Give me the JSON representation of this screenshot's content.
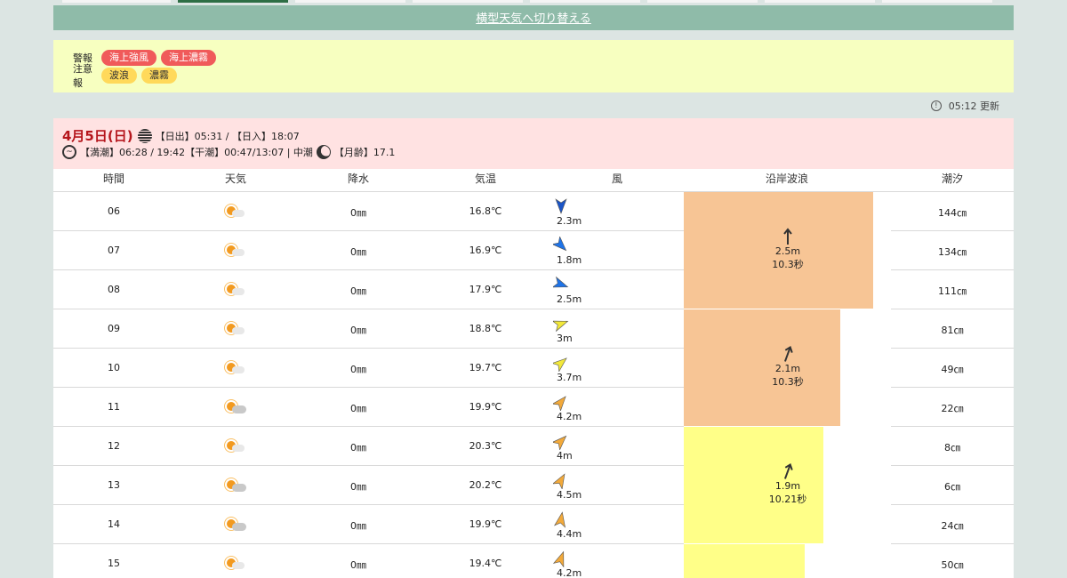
{
  "switch_link": "横型天気へ切り替える",
  "alerts": {
    "warning_label": "警報",
    "warnings": [
      "海上強風",
      "海上濃霧"
    ],
    "advisory_label": "注意報",
    "advisories": [
      "波浪",
      "濃霧"
    ]
  },
  "update": {
    "time": "05:12 更新"
  },
  "day": {
    "date": "4月5日(日)",
    "sun": "【日出】05:31 / 【日入】18:07",
    "tide": "【満潮】06:28 / 19:42【干潮】00:47/13:07 | 中潮",
    "moon": "【月齢】17.1"
  },
  "table": {
    "headers": [
      "時間",
      "天気",
      "降水",
      "気温",
      "風",
      "沿岸波浪",
      "潮汐"
    ],
    "rows": [
      {
        "hour": "06",
        "weather": "sunny-cloudy",
        "rain": "0㎜",
        "temp": "16.8℃",
        "wind_dir": 180,
        "wind_color": "#1a55c8",
        "wind": "2.3m",
        "tide": "144㎝"
      },
      {
        "hour": "07",
        "weather": "sunny-cloudy",
        "rain": "0㎜",
        "temp": "16.9℃",
        "wind_dir": 135,
        "wind_color": "#1e73e8",
        "wind": "1.8m",
        "tide": "134㎝"
      },
      {
        "hour": "08",
        "weather": "sunny-cloudy",
        "rain": "0㎜",
        "temp": "17.9℃",
        "wind_dir": 110,
        "wind_color": "#1e73e8",
        "wind": "2.5m",
        "tide": "111㎝"
      },
      {
        "hour": "09",
        "weather": "sunny-cloudy",
        "rain": "0㎜",
        "temp": "18.8℃",
        "wind_dir": 70,
        "wind_color": "#f2e83a",
        "wind": "3m",
        "tide": "81㎝"
      },
      {
        "hour": "10",
        "weather": "sunny-cloudy",
        "rain": "0㎜",
        "temp": "19.7℃",
        "wind_dir": 50,
        "wind_color": "#f2e83a",
        "wind": "3.7m",
        "tide": "49㎝"
      },
      {
        "hour": "11",
        "weather": "sunny-cloudy2",
        "rain": "0㎜",
        "temp": "19.9℃",
        "wind_dir": 40,
        "wind_color": "#f2a93a",
        "wind": "4.2m",
        "tide": "22㎝"
      },
      {
        "hour": "12",
        "weather": "sunny-cloudy",
        "rain": "0㎜",
        "temp": "20.3℃",
        "wind_dir": 45,
        "wind_color": "#f2a93a",
        "wind": "4m",
        "tide": "8㎝"
      },
      {
        "hour": "13",
        "weather": "sunny-cloudy2",
        "rain": "0㎜",
        "temp": "20.2℃",
        "wind_dir": 30,
        "wind_color": "#f2a93a",
        "wind": "4.5m",
        "tide": "6㎝"
      },
      {
        "hour": "14",
        "weather": "sunny-cloudy2",
        "rain": "0㎜",
        "temp": "19.9℃",
        "wind_dir": 10,
        "wind_color": "#f2a93a",
        "wind": "4.4m",
        "tide": "24㎝"
      },
      {
        "hour": "15",
        "weather": "sunny-cloudy",
        "rain": "0㎜",
        "temp": "19.4℃",
        "wind_dir": 20,
        "wind_color": "#f2a93a",
        "wind": "4.2m",
        "tide": "50㎝"
      }
    ],
    "waves": [
      {
        "height": "2.5m",
        "period": "10.3秒",
        "level": 0.91,
        "color": "#f7c595",
        "dir": 0
      },
      {
        "height": "2.1m",
        "period": "10.3秒",
        "level": 0.75,
        "color": "#f7c595",
        "dir": 20
      },
      {
        "height": "1.9m",
        "period": "10.21秒",
        "level": 0.67,
        "color": "#ffff88",
        "dir": 20
      },
      {
        "level": 0.58,
        "color": "#ffff88"
      }
    ]
  }
}
